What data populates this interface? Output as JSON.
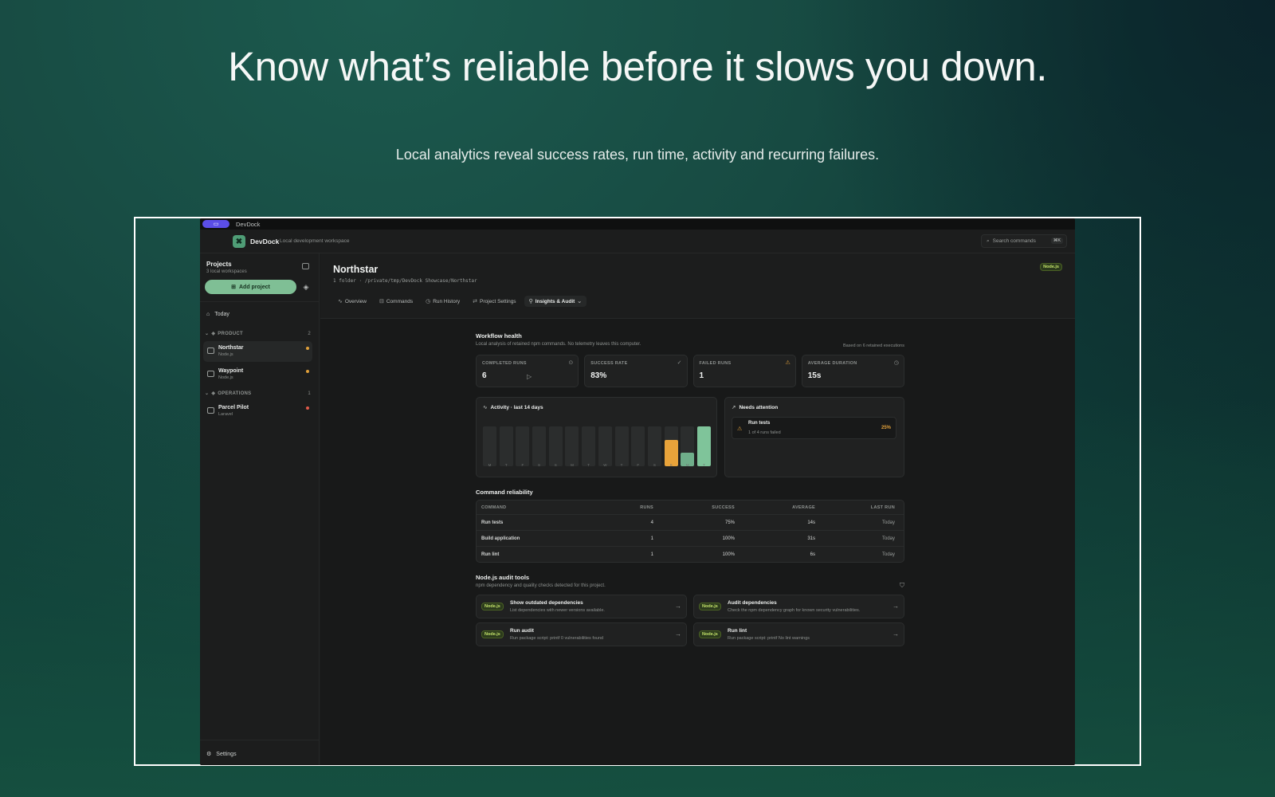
{
  "hero": {
    "headline": "Know what’s reliable before it slows you down.",
    "subline": "Local analytics reveal success rates, run time, activity and recurring failures."
  },
  "window": {
    "title": "DevDock"
  },
  "appbar": {
    "brand": "DevDock",
    "brand_sub": "Local development workspace",
    "search_placeholder": "Search commands",
    "search_kbd": "⌘K"
  },
  "sidebar": {
    "title": "Projects",
    "subtitle": "3 local workspaces",
    "add_label": "Add project",
    "today_label": "Today",
    "groups": [
      {
        "label": "PRODUCT",
        "count": "2"
      },
      {
        "label": "OPERATIONS",
        "count": "1"
      }
    ],
    "projects": [
      {
        "name": "Northstar",
        "type": "Node.js",
        "dot_color": "#e0a03a"
      },
      {
        "name": "Waypoint",
        "type": "Node.js",
        "dot_color": "#e0a03a"
      },
      {
        "name": "Parcel Pilot",
        "type": "Laravel",
        "dot_color": "#e05a4a"
      }
    ],
    "settings_label": "Settings"
  },
  "project": {
    "title": "Northstar",
    "path": "1 folder · /private/tmp/DevDock Showcase/Northstar",
    "badge": "Node.js",
    "tabs": [
      {
        "label": "Overview",
        "icon": "∿"
      },
      {
        "label": "Commands",
        "icon": "⊟"
      },
      {
        "label": "Run History",
        "icon": "◷"
      },
      {
        "label": "Project Settings",
        "icon": "⇄"
      },
      {
        "label": "Insights & Audit",
        "icon": "⚲"
      }
    ]
  },
  "health": {
    "title": "Workflow health",
    "subtitle": "Local analysis of retained npm commands. No telemetry leaves this computer.",
    "note": "Based on 6 retained executions",
    "stats": [
      {
        "label": "COMPLETED RUNS",
        "value": "6",
        "icon": "⊙"
      },
      {
        "label": "SUCCESS RATE",
        "value": "83%",
        "icon": "✓"
      },
      {
        "label": "FAILED RUNS",
        "value": "1",
        "icon": "⚠"
      },
      {
        "label": "AVERAGE DURATION",
        "value": "15s",
        "icon": "◷"
      }
    ]
  },
  "chart_data": {
    "type": "bar",
    "title": "Activity · last 14 days",
    "categories": [
      "M",
      "T",
      "F",
      "S",
      "S",
      "M",
      "T",
      "W",
      "T",
      "F",
      "S",
      "S",
      "M",
      "T"
    ],
    "values": [
      0,
      0,
      0,
      0,
      0,
      0,
      0,
      0,
      0,
      0,
      0,
      2,
      1,
      3
    ],
    "colors": [
      "#2b2d2d",
      "#2b2d2d",
      "#2b2d2d",
      "#2b2d2d",
      "#2b2d2d",
      "#2b2d2d",
      "#2b2d2d",
      "#2b2d2d",
      "#2b2d2d",
      "#2b2d2d",
      "#2b2d2d",
      "#e8a33a",
      "#6fae8a",
      "#7fc49a"
    ],
    "ylim": [
      0,
      3
    ]
  },
  "attention": {
    "title": "Needs attention",
    "item_name": "Run tests",
    "item_desc": "1 of 4 runs failed",
    "item_pct": "25%"
  },
  "reliability": {
    "title": "Command reliability",
    "headers": [
      "COMMAND",
      "RUNS",
      "SUCCESS",
      "AVERAGE",
      "LAST RUN"
    ],
    "rows": [
      [
        "Run tests",
        "4",
        "75%",
        "14s",
        "Today"
      ],
      [
        "Build application",
        "1",
        "100%",
        "31s",
        "Today"
      ],
      [
        "Run lint",
        "1",
        "100%",
        "6s",
        "Today"
      ]
    ]
  },
  "audit": {
    "title": "Node.js audit tools",
    "subtitle": "npm dependency and quality checks detected for this project.",
    "tools": [
      {
        "badge": "Node.js",
        "name": "Show outdated dependencies",
        "desc": "List dependencies with newer versions available."
      },
      {
        "badge": "Node.js",
        "name": "Audit dependencies",
        "desc": "Check the npm dependency graph for known security vulnerabilities."
      },
      {
        "badge": "Node.js",
        "name": "Run audit",
        "desc": "Run package script: printf 0 vulnerabilities found"
      },
      {
        "badge": "Node.js",
        "name": "Run lint",
        "desc": "Run package script: printf No lint warnings"
      }
    ]
  }
}
